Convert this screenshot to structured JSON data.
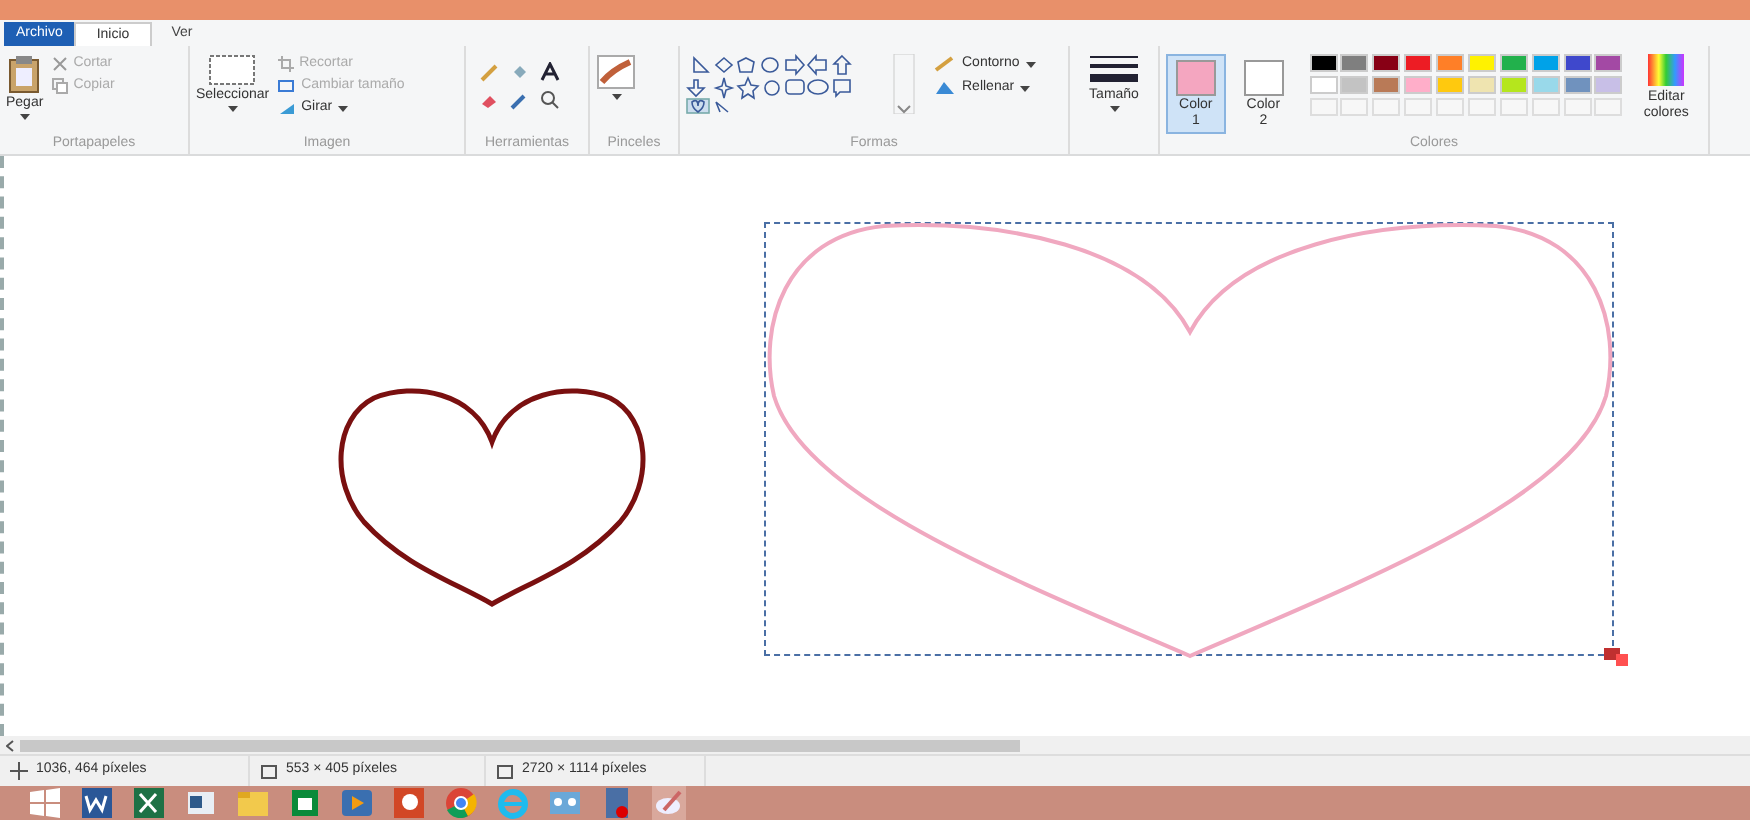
{
  "tabs": [
    {
      "label": "Archivo",
      "kind": "file",
      "selected": false
    },
    {
      "label": "Inicio",
      "kind": "tab",
      "selected": true
    },
    {
      "label": "Ver",
      "kind": "tab",
      "selected": false
    }
  ],
  "clipboard": {
    "paste": "Pegar",
    "cut": "Cortar",
    "copy": "Copiar",
    "label": "Portapapeles"
  },
  "image": {
    "select": "Seleccionar",
    "crop": "Recortar",
    "resize": "Cambiar tamaño",
    "rotate": "Girar",
    "label": "Imagen"
  },
  "tools": {
    "label": "Herramientas"
  },
  "brushes": {
    "label": "Pinceles"
  },
  "shapes": {
    "outline": "Contorno",
    "fill": "Rellenar",
    "label": "Formas"
  },
  "size": {
    "label": "Tamaño"
  },
  "colors": {
    "color1": {
      "label": "Color",
      "sub": "1",
      "color": "#f4a6c0",
      "selected": true
    },
    "color2": {
      "label": "Color",
      "sub": "2",
      "color": "#ffffff",
      "selected": false
    },
    "palette": [
      {
        "color": "#000000"
      },
      {
        "color": "#7f7f7f"
      },
      {
        "color": "#880015"
      },
      {
        "color": "#ed1c24"
      },
      {
        "color": "#ff7f27"
      },
      {
        "color": "#fff200"
      },
      {
        "color": "#22b14c"
      },
      {
        "color": "#00a2e8"
      },
      {
        "color": "#3f48cc"
      },
      {
        "color": "#a349a4"
      },
      {
        "color": "#ffffff"
      },
      {
        "color": "#c3c3c3"
      },
      {
        "color": "#b97a57"
      },
      {
        "color": "#ffaec9"
      },
      {
        "color": "#ffc90e"
      },
      {
        "color": "#efe4b0"
      },
      {
        "color": "#b5e61d"
      },
      {
        "color": "#99d9ea"
      },
      {
        "color": "#7092be"
      },
      {
        "color": "#c8bfe7"
      }
    ],
    "edit": "Editar colores",
    "label": "Colores"
  },
  "status_bar": {
    "cursor": "1036, 464 píxeles",
    "selection": "553 × 405 píxeles",
    "image_size": "2720 × 1114 píxeles"
  }
}
